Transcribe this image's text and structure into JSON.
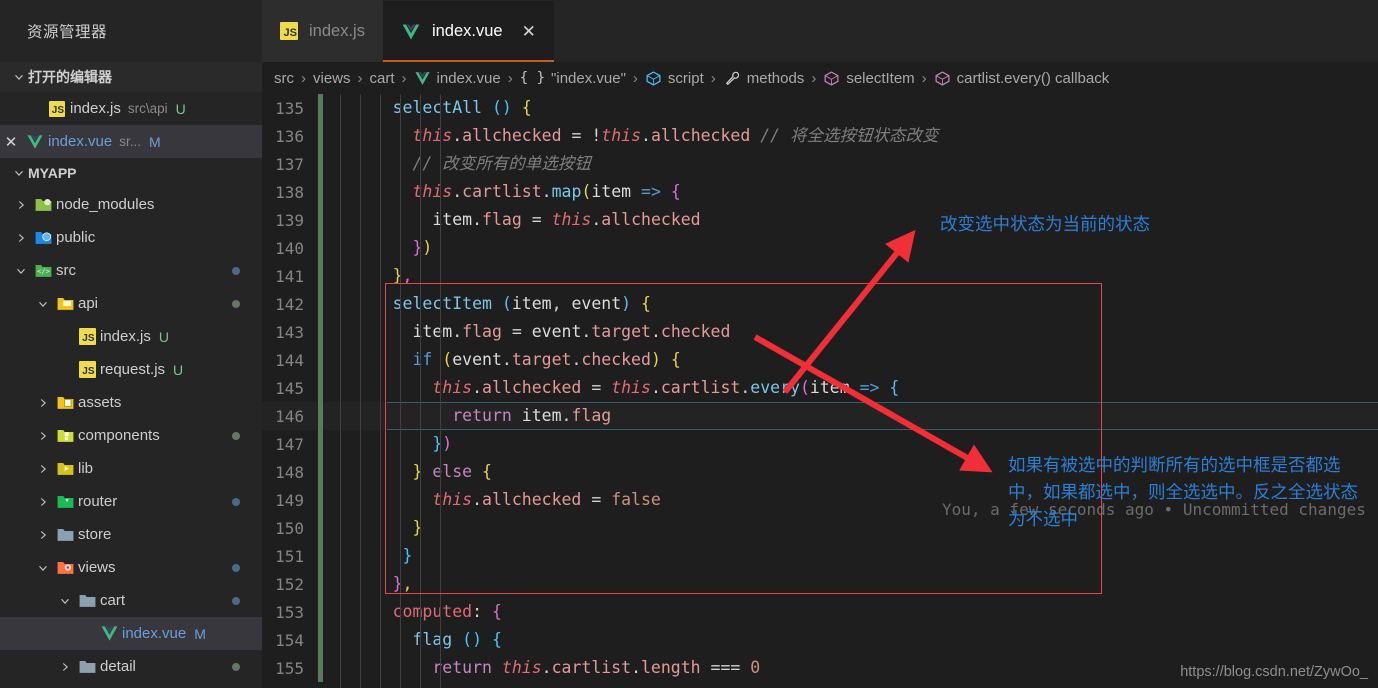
{
  "sidebar": {
    "title": "资源管理器",
    "open_editors": {
      "label": "打开的编辑器",
      "items": [
        {
          "name": "index.js",
          "path": "src\\api",
          "badge": "U",
          "icon": "js-file-icon",
          "selected": false,
          "closable": false
        },
        {
          "name": "index.vue",
          "path": "sr...",
          "badge": "M",
          "icon": "vue-file-icon",
          "selected": true,
          "closable": true
        }
      ]
    },
    "project": {
      "label": "MYAPP",
      "tree": [
        {
          "label": "node_modules",
          "type": "folder",
          "indent": 1,
          "expanded": false,
          "icon": "folder-node-modules-icon",
          "badge": "",
          "dot": ""
        },
        {
          "label": "public",
          "type": "folder",
          "indent": 1,
          "expanded": false,
          "icon": "folder-public-icon",
          "badge": "",
          "dot": ""
        },
        {
          "label": "src",
          "type": "folder",
          "indent": 1,
          "expanded": true,
          "icon": "folder-src-icon",
          "badge": "",
          "dot": "#4b6a8a"
        },
        {
          "label": "api",
          "type": "folder",
          "indent": 2,
          "expanded": true,
          "icon": "folder-api-icon",
          "badge": "",
          "dot": "#5f7a5f"
        },
        {
          "label": "index.js",
          "type": "file",
          "indent": 3,
          "expanded": false,
          "icon": "js-file-icon",
          "badge": "U",
          "dot": ""
        },
        {
          "label": "request.js",
          "type": "file",
          "indent": 3,
          "expanded": false,
          "icon": "js-file-icon",
          "badge": "U",
          "dot": ""
        },
        {
          "label": "assets",
          "type": "folder",
          "indent": 2,
          "expanded": false,
          "icon": "folder-assets-icon",
          "badge": "",
          "dot": ""
        },
        {
          "label": "components",
          "type": "folder",
          "indent": 2,
          "expanded": false,
          "icon": "folder-components-icon",
          "badge": "",
          "dot": "#5f7a5f"
        },
        {
          "label": "lib",
          "type": "folder",
          "indent": 2,
          "expanded": false,
          "icon": "folder-lib-icon",
          "badge": "",
          "dot": ""
        },
        {
          "label": "router",
          "type": "folder",
          "indent": 2,
          "expanded": false,
          "icon": "folder-router-icon",
          "badge": "",
          "dot": "#4b6a8a"
        },
        {
          "label": "store",
          "type": "folder",
          "indent": 2,
          "expanded": false,
          "icon": "folder-icon",
          "badge": "",
          "dot": ""
        },
        {
          "label": "views",
          "type": "folder",
          "indent": 2,
          "expanded": true,
          "icon": "folder-views-icon",
          "badge": "",
          "dot": "#4b6a8a"
        },
        {
          "label": "cart",
          "type": "folder",
          "indent": 3,
          "expanded": true,
          "icon": "folder-icon",
          "badge": "",
          "dot": "#4b6a8a"
        },
        {
          "label": "index.vue",
          "type": "file",
          "indent": 4,
          "expanded": false,
          "icon": "vue-file-icon",
          "badge": "M",
          "dot": "",
          "selected": true
        },
        {
          "label": "detail",
          "type": "folder",
          "indent": 3,
          "expanded": false,
          "icon": "folder-icon",
          "badge": "",
          "dot": "#5f7a5f"
        }
      ]
    }
  },
  "tabs": [
    {
      "label": "index.js",
      "icon": "js-file-icon",
      "active": false,
      "closable": false
    },
    {
      "label": "index.vue",
      "icon": "vue-file-icon",
      "active": true,
      "closable": true
    }
  ],
  "breadcrumb": [
    {
      "label": "src",
      "icon": ""
    },
    {
      "label": "views",
      "icon": ""
    },
    {
      "label": "cart",
      "icon": ""
    },
    {
      "label": "index.vue",
      "icon": "vue-file-icon"
    },
    {
      "label": "\"index.vue\"",
      "icon": "braces-icon"
    },
    {
      "label": "script",
      "icon": "cube-blue-icon"
    },
    {
      "label": "methods",
      "icon": "wrench-icon"
    },
    {
      "label": "selectItem",
      "icon": "cube-purple-icon"
    },
    {
      "label": "cartlist.every() callback",
      "icon": "cube-purple-icon"
    }
  ],
  "code": {
    "first_line_number": 135,
    "current_line": 146,
    "blame": "You, a few seconds ago • Uncommitted changes",
    "lines": [
      {
        "n": 135,
        "html": "<span class='t-fn'>selectAll</span> <span class='t-par-b'>()</span> <span class='t-par-y'>{</span>",
        "indent": 3
      },
      {
        "n": 136,
        "html": "  <span class='t-this'>this</span><span class='t-op'>.</span><span class='t-prop'>allchecked</span> <span class='t-op'>=</span> <span class='t-op'>!</span><span class='t-this'>this</span><span class='t-op'>.</span><span class='t-prop'>allchecked</span> <span class='t-cmt-cn'>// 将全选按钮状态改变</span>",
        "indent": 4
      },
      {
        "n": 137,
        "html": "  <span class='t-cmt-cn'>// 改变所有的单选按钮</span>",
        "indent": 4
      },
      {
        "n": 138,
        "html": "  <span class='t-this'>this</span><span class='t-op'>.</span><span class='t-prop'>cartlist</span><span class='t-op'>.</span><span class='t-fn'>map</span><span class='t-par-y'>(</span><span class='t-var'>item</span> <span class='t-arrow'>=&gt;</span> <span class='t-par-p'>{</span>",
        "indent": 4
      },
      {
        "n": 139,
        "html": "    <span class='t-var'>item</span><span class='t-op'>.</span><span class='t-prop'>flag</span> <span class='t-op'>=</span> <span class='t-this'>this</span><span class='t-op'>.</span><span class='t-prop'>allchecked</span>",
        "indent": 5
      },
      {
        "n": 140,
        "html": "  <span class='t-par-p'>}</span><span class='t-par-y'>)</span>",
        "indent": 4
      },
      {
        "n": 141,
        "html": "<span class='t-par-y'>}</span><span class='t-par-p'>,</span>",
        "indent": 3
      },
      {
        "n": 142,
        "html": "<span class='t-fn'>selectItem</span> <span class='t-par-b'>(</span><span class='t-var'>item</span><span class='t-op'>,</span> <span class='t-var'>event</span><span class='t-par-b'>)</span> <span class='t-par-y'>{</span>",
        "indent": 3
      },
      {
        "n": 143,
        "html": "  <span class='t-var'>item</span><span class='t-op'>.</span><span class='t-prop'>flag</span> <span class='t-op'>=</span> <span class='t-var'>event</span><span class='t-op'>.</span><span class='t-prop'>target</span><span class='t-op'>.</span><span class='t-prop'>checked</span>",
        "indent": 4
      },
      {
        "n": 144,
        "html": "  <span class='t-kw2'>if</span> <span class='t-par-y'>(</span><span class='t-var'>event</span><span class='t-op'>.</span><span class='t-prop'>target</span><span class='t-op'>.</span><span class='t-prop'>checked</span><span class='t-par-y'>)</span> <span class='t-par-y'>{</span>",
        "indent": 4
      },
      {
        "n": 145,
        "html": "    <span class='t-this'>this</span><span class='t-op'>.</span><span class='t-prop'>allchecked</span> <span class='t-op'>=</span> <span class='t-this'>this</span><span class='t-op'>.</span><span class='t-prop'>cartlist</span><span class='t-op'>.</span><span class='t-fn'>every</span><span class='t-par-p'>(</span><span class='t-var'>item</span> <span class='t-arrow'>=&gt;</span> <span class='t-par-b'>{</span>",
        "indent": 5
      },
      {
        "n": 146,
        "html": "      <span class='t-kw'>return</span> <span class='t-var'>item</span><span class='t-op'>.</span><span class='t-prop'>flag</span>",
        "indent": 6
      },
      {
        "n": 147,
        "html": "    <span class='t-par-b'>}</span><span class='t-par-p'>)</span>",
        "indent": 5
      },
      {
        "n": 148,
        "html": "  <span class='t-par-y'>}</span> <span class='t-kw'>else</span> <span class='t-par-y'>{</span>",
        "indent": 4
      },
      {
        "n": 149,
        "html": "    <span class='t-this'>this</span><span class='t-op'>.</span><span class='t-prop'>allchecked</span> <span class='t-op'>=</span> <span class='t-bool'>false</span>",
        "indent": 5
      },
      {
        "n": 150,
        "html": "  <span class='t-par-y'>}</span>",
        "indent": 4
      },
      {
        "n": 151,
        "html": " <span class='t-par-b'>}</span>",
        "indent": 4
      },
      {
        "n": 152,
        "html": "<span class='t-par-p'>}</span><span class='t-par-y'>,</span>",
        "indent": 3
      },
      {
        "n": 153,
        "html": "<span class='t-key'>computed</span><span class='t-op'>:</span> <span class='t-par-p'>{</span>",
        "indent": 3
      },
      {
        "n": 154,
        "html": "  <span class='t-fn'>flag</span> <span class='t-par-b'>()</span> <span class='t-par-b'>{</span>",
        "indent": 4
      },
      {
        "n": 155,
        "html": "    <span class='t-kw'>return</span> <span class='t-this'>this</span><span class='t-op'>.</span><span class='t-prop'>cartlist</span><span class='t-op'>.</span><span class='t-prop'>length</span> <span class='t-op'>===</span> <span class='t-num'>0</span>",
        "indent": 5
      }
    ]
  },
  "annotations": {
    "color": "#2c7fd4",
    "box_color": "#e8444a",
    "note1": "改变选中状态为当前的状态",
    "note2": "如果有被选中的判断所有的选中框是否都选中，如果都选中，则全选选中。反之全选状态为不选中"
  },
  "watermark": "https://blog.csdn.net/ZywOo_"
}
